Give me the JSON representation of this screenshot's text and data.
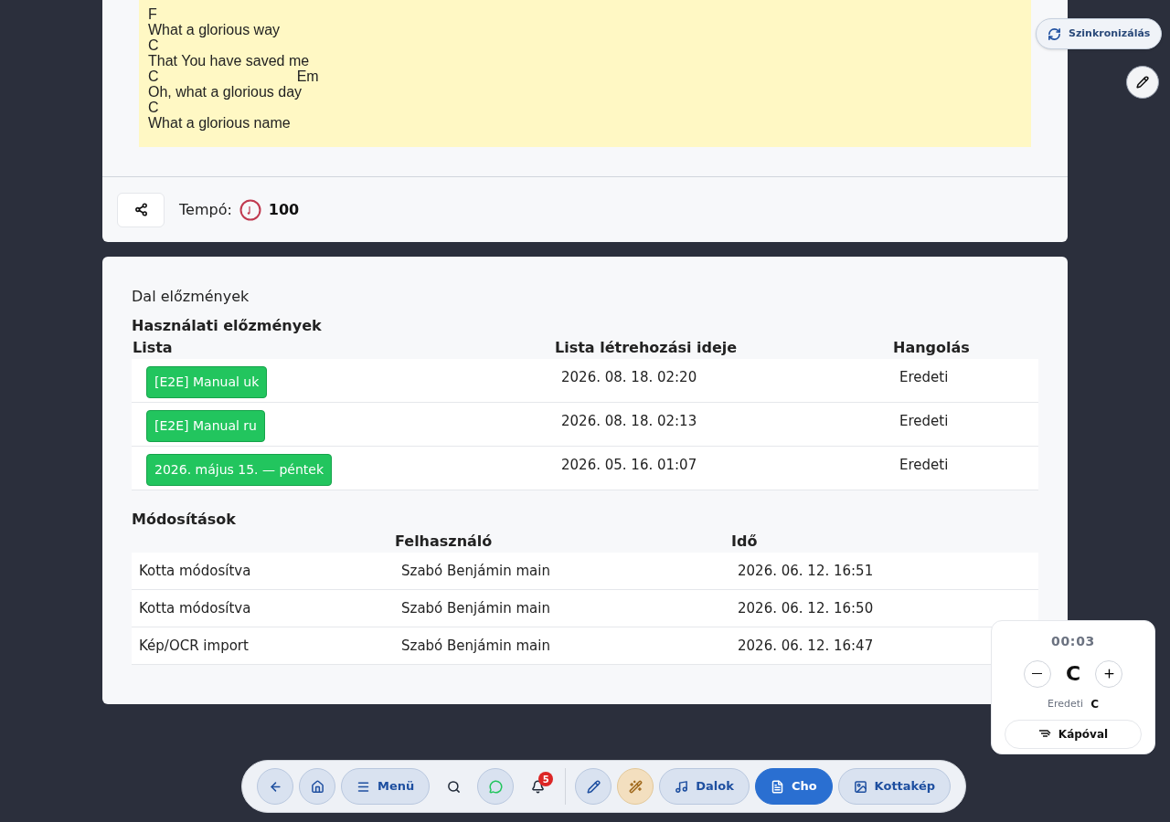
{
  "lyrics": [
    "F",
    "What a glorious way",
    "C",
    "That You have saved me",
    "C                                  Em",
    "Oh, what a glorious day",
    "C",
    "What a glorious name"
  ],
  "sync_button": "Szinkronizálás",
  "tempo": {
    "label": "Tempó:",
    "value": "100"
  },
  "history": {
    "title": "Dal előzmények",
    "usage": {
      "title": "Használati előzmények",
      "columns": [
        "Lista",
        "Lista létrehozási ideje",
        "Hangolás"
      ],
      "rows": [
        {
          "list": "[E2E] Manual uk",
          "created": "2026. 08. 18. 02:20",
          "tuning": "Eredeti"
        },
        {
          "list": "[E2E] Manual ru",
          "created": "2026. 08. 18. 02:13",
          "tuning": "Eredeti"
        },
        {
          "list": "2026. május 15. — péntek",
          "created": "2026. 05. 16. 01:07",
          "tuning": "Eredeti"
        }
      ]
    },
    "changes": {
      "title": "Módosítások",
      "columns": [
        "Felhasználó",
        "Idő"
      ],
      "rows": [
        {
          "action": "Kotta módosítva",
          "user": "Szabó Benjámin main",
          "time": "2026. 06. 12. 16:51"
        },
        {
          "action": "Kotta módosítva",
          "user": "Szabó Benjámin main",
          "time": "2026. 06. 12. 16:50"
        },
        {
          "action": "Kép/OCR import",
          "user": "Szabó Benjámin main",
          "time": "2026. 06. 12. 16:47"
        }
      ]
    }
  },
  "transpose": {
    "timer": "00:03",
    "key": "C",
    "original_label": "Eredeti",
    "original_key": "C",
    "capo_button": "Kápóval"
  },
  "toolbar": [
    {
      "kind": "icon",
      "selected": false
    },
    {
      "kind": "icon",
      "selected": false
    },
    {
      "kind": "label",
      "label": "Menü",
      "selected": false
    },
    {
      "kind": "plain",
      "selected": false
    },
    {
      "kind": "icon",
      "selected": false
    },
    {
      "kind": "plain",
      "badge": "5",
      "selected": false
    },
    {
      "kind": "divider"
    },
    {
      "kind": "icon",
      "selected": false
    },
    {
      "kind": "accent",
      "selected": false
    },
    {
      "kind": "label",
      "label": "Dalok",
      "selected": false
    },
    {
      "kind": "label",
      "label": "Cho",
      "selected": true
    },
    {
      "kind": "label",
      "label": "Kottakép",
      "selected": false
    }
  ]
}
